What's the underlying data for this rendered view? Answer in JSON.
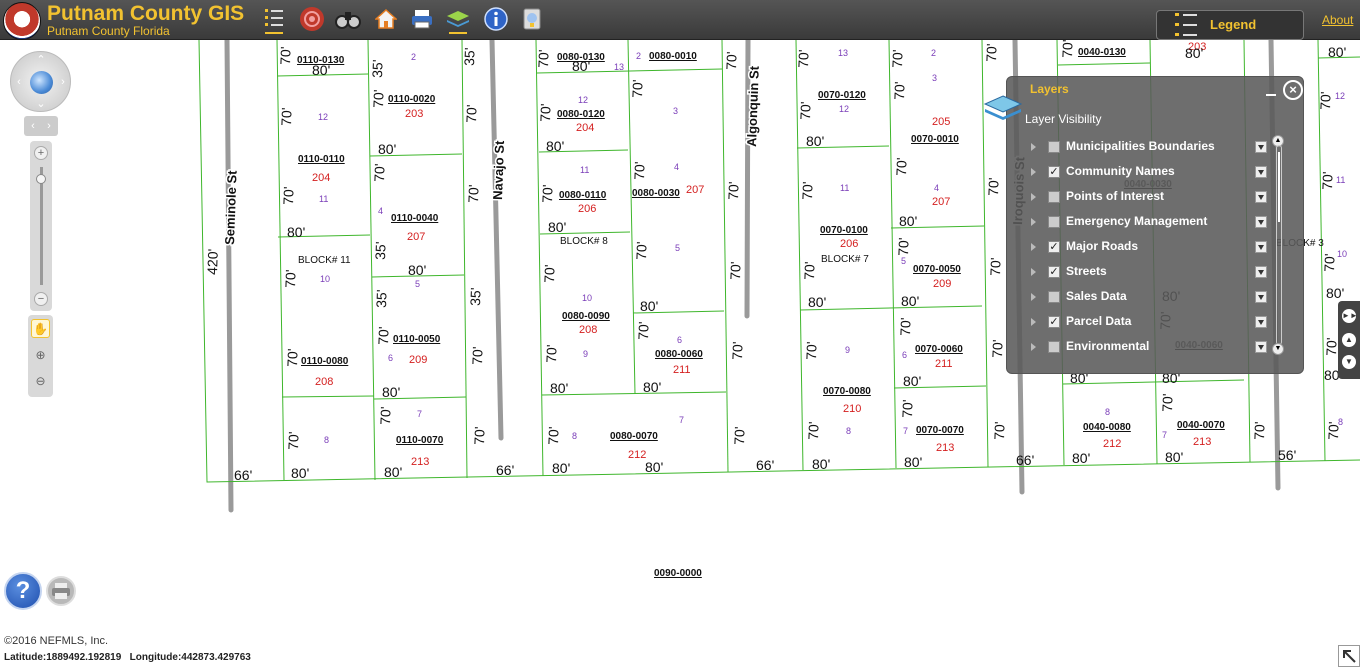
{
  "header": {
    "title": "Putnam County GIS",
    "subtitle": "Putnam County Florida",
    "legend_label": "Legend",
    "about_label": "About",
    "tools": [
      {
        "name": "layer-list-tool-icon"
      },
      {
        "name": "target-tool-icon"
      },
      {
        "name": "binoculars-icon"
      },
      {
        "name": "home-icon"
      },
      {
        "name": "print-icon"
      },
      {
        "name": "layers-tool-icon"
      },
      {
        "name": "info-icon"
      },
      {
        "name": "measure-icon"
      }
    ]
  },
  "layers_panel": {
    "title": "Layers",
    "subtitle": "Layer Visibility",
    "items": [
      {
        "label": "Municipalities Boundaries",
        "checked": false
      },
      {
        "label": "Community Names",
        "checked": true
      },
      {
        "label": "Points of Interest",
        "checked": false
      },
      {
        "label": "Emergency Management",
        "checked": false
      },
      {
        "label": "Major Roads",
        "checked": true
      },
      {
        "label": "Streets",
        "checked": true
      },
      {
        "label": "Sales Data",
        "checked": false
      },
      {
        "label": "Parcel Data",
        "checked": true
      },
      {
        "label": "Environmental",
        "checked": false
      }
    ]
  },
  "map": {
    "streets": [
      "Seminole St",
      "Navajo St",
      "Algonquin St",
      "Iroquois St"
    ],
    "blocks": [
      "BLOCK# 11",
      "BLOCK# 8",
      "BLOCK# 7",
      "BLOCK# 3"
    ],
    "parcels": [
      "0110-0130",
      "0110-0020",
      "0110-0110",
      "0110-0040",
      "0110-0050",
      "0110-0080",
      "0110-0070",
      "0080-0130",
      "0080-0010",
      "0080-0120",
      "0080-0110",
      "0080-0030",
      "0080-0090",
      "0080-0060",
      "0080-0070",
      "0070-0120",
      "0070-0010",
      "0070-0100",
      "0070-0050",
      "0070-0060",
      "0070-0080",
      "0070-0070",
      "0040-0130",
      "0040-0030",
      "0040-0060",
      "0040-0080",
      "0040-0070",
      "0090-0000"
    ],
    "dimensions": [
      "420'",
      "80'",
      "70'",
      "35'",
      "66'",
      "56'"
    ]
  },
  "footer": {
    "copyright": "©2016 NEFMLS, Inc.",
    "lat_label": "Latitude:",
    "lat_value": "1889492.192819",
    "lon_label": "Longitude:",
    "lon_value": "442873.429763"
  },
  "colors": {
    "accent": "#f2c230",
    "parcel_line": "#3fb62c",
    "lot_number": "#7a3db8",
    "address_number": "#d42020"
  }
}
